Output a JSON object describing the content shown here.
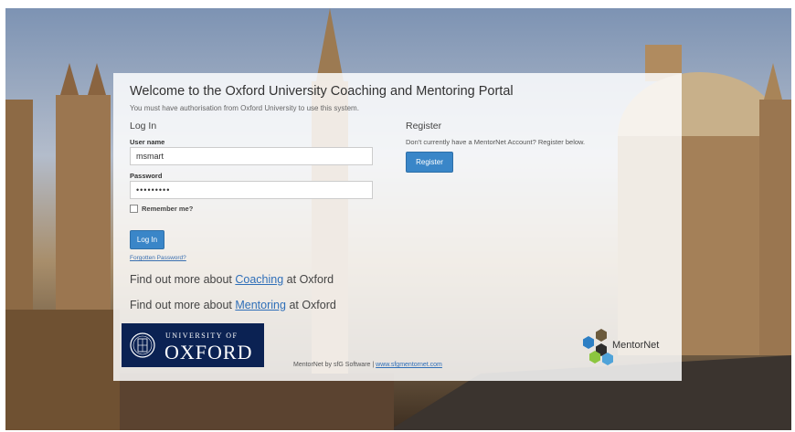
{
  "portal": {
    "title": "Welcome to the Oxford University Coaching and Mentoring Portal",
    "subtitle": "You must have authorisation from Oxford University to use this system."
  },
  "login": {
    "heading": "Log In",
    "username_label": "User name",
    "username_value": "msmart",
    "password_label": "Password",
    "password_value": "•••••••••",
    "remember_label": "Remember me?",
    "login_button": "Log In",
    "forgot_link": "Forgotten Password?"
  },
  "register": {
    "heading": "Register",
    "text": "Don't currently have a MentorNet Account? Register below.",
    "button": "Register"
  },
  "findout": {
    "coaching_prefix": "Find out more about",
    "coaching_link": "Coaching",
    "coaching_suffix": "at Oxford",
    "mentoring_prefix": "Find out more about",
    "mentoring_link": "Mentoring",
    "mentoring_suffix": "at Oxford"
  },
  "oxford_logo": {
    "university_of": "UNIVERSITY OF",
    "oxford": "OXFORD"
  },
  "footer": {
    "text": "MentorNet by sfG Software |",
    "link": "www.sfgmentornet.com"
  },
  "mentornet_logo": {
    "name": "MentorNet",
    "colors": [
      "#6b5a3c",
      "#2d7fc4",
      "#8cc63f",
      "#2d2d2d",
      "#4fa3d9"
    ]
  },
  "colors": {
    "button": "#3a86c8",
    "link": "#2f6fb8",
    "oxford_blue": "#0b2253"
  }
}
